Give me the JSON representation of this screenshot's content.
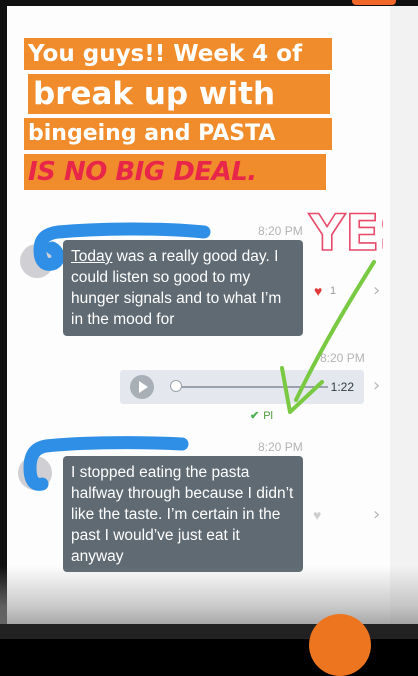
{
  "banner": {
    "line1": "You guys!! Week 4 of",
    "line2": "break up with",
    "line3": "bingeing and PASTA",
    "line4": "IS NO BIG DEAL."
  },
  "sticker": {
    "yes_text": "YES!"
  },
  "messages": [
    {
      "time": "8:20 PM",
      "underlined_word": "Today",
      "text_rest": " was a really good day. I could listen so good to my hunger signals and to what I’m in the mood for",
      "likes": "1",
      "liked": true
    },
    {
      "time": "8:20 PM",
      "audio_duration": "1:22",
      "status": "Played",
      "status_visible": "Pl"
    },
    {
      "time": "8:20 PM",
      "text": "I stopped eating the pasta halfway through because I didn’t like the taste. I’m certain in the past I would’ve just eat it anyway",
      "liked": false
    }
  ],
  "colors": {
    "banner_bg": "#f08c2b",
    "banner_text": "#ffffff",
    "banner_accent": "#e8264a",
    "bubble_bg": "#5f6a72",
    "scribble": "#2f8fe6",
    "arrow": "#7ac943",
    "fab": "#ee7520"
  },
  "icons": {
    "like_active": "heart-filled-icon",
    "like_inactive": "heart-outline-icon",
    "more": "chevron-right-icon",
    "play": "play-icon",
    "check": "check-icon"
  }
}
